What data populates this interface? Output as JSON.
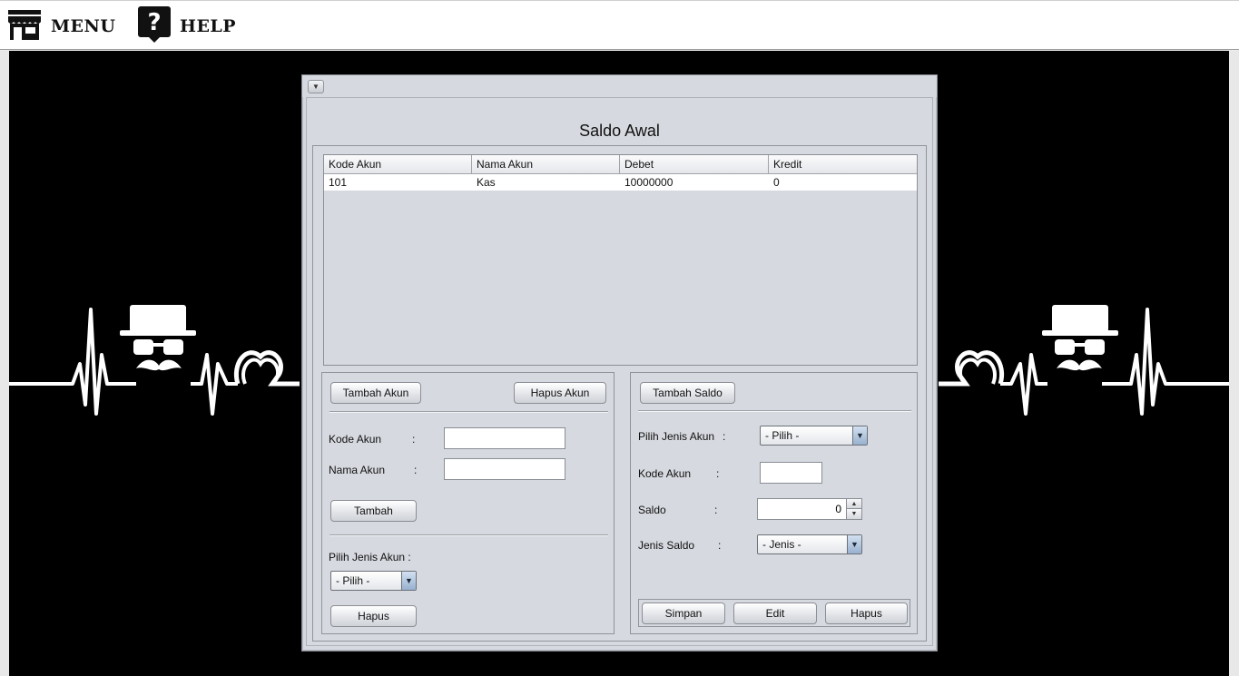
{
  "menubar": {
    "menu_label": "MENU",
    "help_label": "HELP"
  },
  "frame": {
    "title": "Saldo Awal",
    "table": {
      "columns": [
        "Kode Akun",
        "Nama Akun",
        "Debet",
        "Kredit"
      ],
      "rows": [
        [
          "101",
          "Kas",
          "10000000",
          "0"
        ]
      ]
    },
    "left": {
      "tambah_akun": "Tambah Akun",
      "hapus_akun": "Hapus Akun",
      "kode_akun_label": "Kode Akun",
      "nama_akun_label": "Nama Akun",
      "colon": ":",
      "kode_akun_value": "",
      "nama_akun_value": "",
      "tambah": "Tambah",
      "pilih_jenis_label": "Pilih Jenis Akun :",
      "pilih_value": "- Pilih -",
      "hapus": "Hapus"
    },
    "right": {
      "tambah_saldo": "Tambah Saldo",
      "pilih_jenis_label": "Pilih Jenis Akun",
      "pilih_value": "- Pilih -",
      "kode_akun_label": "Kode Akun",
      "kode_akun_value": "",
      "saldo_label": "Saldo",
      "saldo_value": "0",
      "jenis_saldo_label": "Jenis Saldo",
      "jenis_value": "- Jenis -",
      "colon": ":",
      "simpan": "Simpan",
      "edit": "Edit",
      "hapus": "Hapus"
    }
  }
}
